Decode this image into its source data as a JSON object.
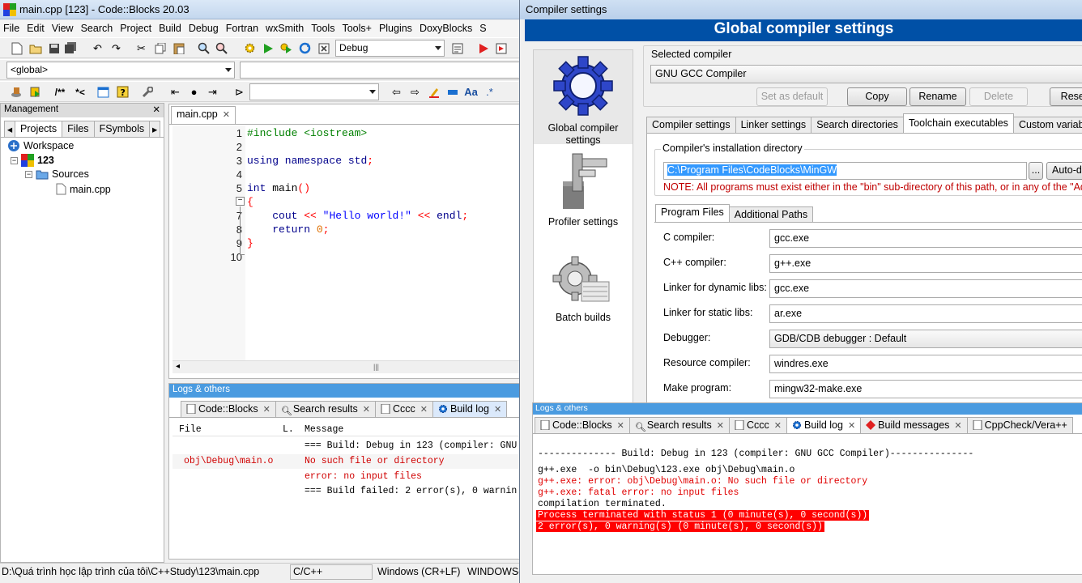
{
  "cb": {
    "title": "main.cpp [123] - Code::Blocks 20.03",
    "menu": [
      "File",
      "Edit",
      "View",
      "Search",
      "Project",
      "Build",
      "Debug",
      "Fortran",
      "wxSmith",
      "Tools",
      "Tools+",
      "Plugins",
      "DoxyBlocks",
      "S"
    ],
    "build_target": "Debug",
    "scope_combo": "<global>",
    "management": {
      "header": "Management",
      "tabs": [
        "Projects",
        "Files",
        "FSymbols"
      ],
      "tree": {
        "workspace": "Workspace",
        "project": "123",
        "folder": "Sources",
        "file": "main.cpp"
      }
    },
    "editor": {
      "tab": "main.cpp",
      "line_numbers": [
        "1",
        "2",
        "3",
        "4",
        "5",
        "6",
        "7",
        "8",
        "9",
        "10"
      ]
    },
    "logs": {
      "header": "Logs & others",
      "tabs": [
        "Code::Blocks",
        "Search results",
        "Cccc",
        "Build log"
      ],
      "columns": [
        "File",
        "L.",
        "Message"
      ],
      "rows": [
        {
          "file": "",
          "line": "",
          "message": "=== Build: Debug in 123 (compiler: GNU"
        },
        {
          "file": "obj\\Debug\\main.o",
          "line": "",
          "message": "No such file or directory"
        },
        {
          "file": "",
          "line": "",
          "message": "error: no input files"
        },
        {
          "file": "",
          "line": "",
          "message": "=== Build failed: 2 error(s), 0 warnin"
        }
      ]
    },
    "status": {
      "path": "D:\\Quá trình học lập trình của tôi\\C++Study\\123\\main.cpp",
      "lang": "C/C++",
      "eol": "Windows (CR+LF)",
      "encoding": "WINDOWS-"
    }
  },
  "dlg": {
    "title": "Compiler settings",
    "banner": "Global compiler settings",
    "nav": [
      "Global compiler settings",
      "Profiler settings",
      "Batch builds"
    ],
    "selected_compiler_label": "Selected compiler",
    "selected_compiler": "GNU GCC Compiler",
    "buttons": {
      "set_default": "Set as default",
      "copy": "Copy",
      "rename": "Rename",
      "delete": "Delete",
      "reset": "Reset"
    },
    "tabs": [
      "Compiler settings",
      "Linker settings",
      "Search directories",
      "Toolchain executables",
      "Custom variables"
    ],
    "install_dir_label": "Compiler's installation directory",
    "install_dir": "C:\\Program Files\\CodeBlocks\\MinGW",
    "browse": "...",
    "auto_detect": "Auto-d",
    "note": "NOTE: All programs must exist either in the \"bin\" sub-directory of this path, or in any of the \"Addit",
    "subtabs": [
      "Program Files",
      "Additional Paths"
    ],
    "programs": [
      {
        "label": "C compiler:",
        "value": "gcc.exe"
      },
      {
        "label": "C++ compiler:",
        "value": "g++.exe"
      },
      {
        "label": "Linker for dynamic libs:",
        "value": "gcc.exe"
      },
      {
        "label": "Linker for static libs:",
        "value": "ar.exe"
      },
      {
        "label": "Debugger:",
        "value": "GDB/CDB debugger : Default"
      },
      {
        "label": "Resource compiler:",
        "value": "windres.exe"
      },
      {
        "label": "Make program:",
        "value": "mingw32-make.exe"
      }
    ],
    "logs": {
      "header": "Logs & others",
      "tabs": [
        "Code::Blocks",
        "Search results",
        "Cccc",
        "Build log",
        "Build messages",
        "CppCheck/Vera++"
      ],
      "lines": [
        "-------------- Build: Debug in 123 (compiler: GNU GCC Compiler)---------------",
        "g++.exe  -o bin\\Debug\\123.exe obj\\Debug\\main.o",
        "g++.exe: error: obj\\Debug\\main.o: No such file or directory",
        "g++.exe: fatal error: no input files",
        "compilation terminated.",
        "Process terminated with status 1 (0 minute(s), 0 second(s))",
        "2 error(s), 0 warning(s) (0 minute(s), 0 second(s))"
      ]
    }
  }
}
